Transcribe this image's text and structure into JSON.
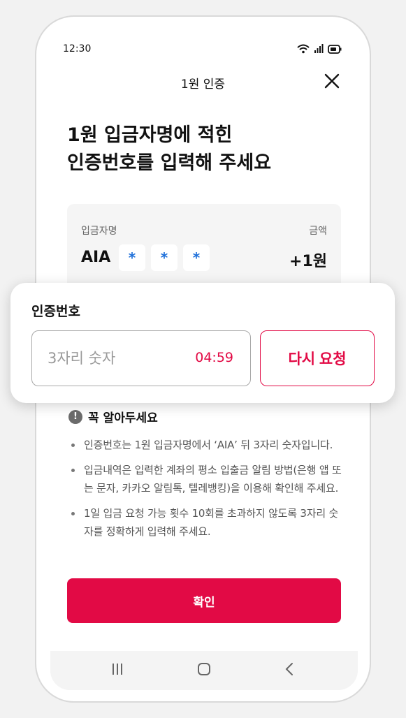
{
  "status_bar": {
    "time": "12:30",
    "icons": [
      "wifi-icon",
      "signal-icon",
      "battery-icon"
    ]
  },
  "header": {
    "title": "1원 인증",
    "close_icon": "close-icon"
  },
  "headline": {
    "line1": "1원 입금자명에 적힌",
    "line2": "인증번호를 입력해 주세요"
  },
  "deposit_info": {
    "sender_label": "입금자명",
    "amount_label": "금액",
    "sender_name": "AIA",
    "mask_chars": [
      "*",
      "*",
      "*"
    ],
    "amount": "+1원"
  },
  "verification": {
    "label": "인증번호",
    "placeholder": "3자리 숫자",
    "value": "",
    "timer": "04:59",
    "resend_label": "다시 요청"
  },
  "notice": {
    "title": "꼭 알아두세요",
    "items": [
      "인증번호는 1원 입금자명에서 ‘AIA’ 뒤 3자리 숫자입니다.",
      "입금내역은 입력한 계좌의 평소 입출금 알림 방법(은행 앱 또는 문자, 카카오 알림톡, 텔레뱅킹)을 이용해 확인해 주세요.",
      "1일 입금 요청 가능 횟수 10회를 초과하지 않도록 3자리 숫자를 정확하게 입력해 주세요."
    ]
  },
  "confirm_label": "확인",
  "nav_bar": {
    "icons": [
      "recent-apps-icon",
      "home-icon",
      "back-icon"
    ]
  },
  "colors": {
    "accent": "#e20a45",
    "mask_star": "#1e6fd9",
    "card_bg": "#f5f5f5"
  }
}
